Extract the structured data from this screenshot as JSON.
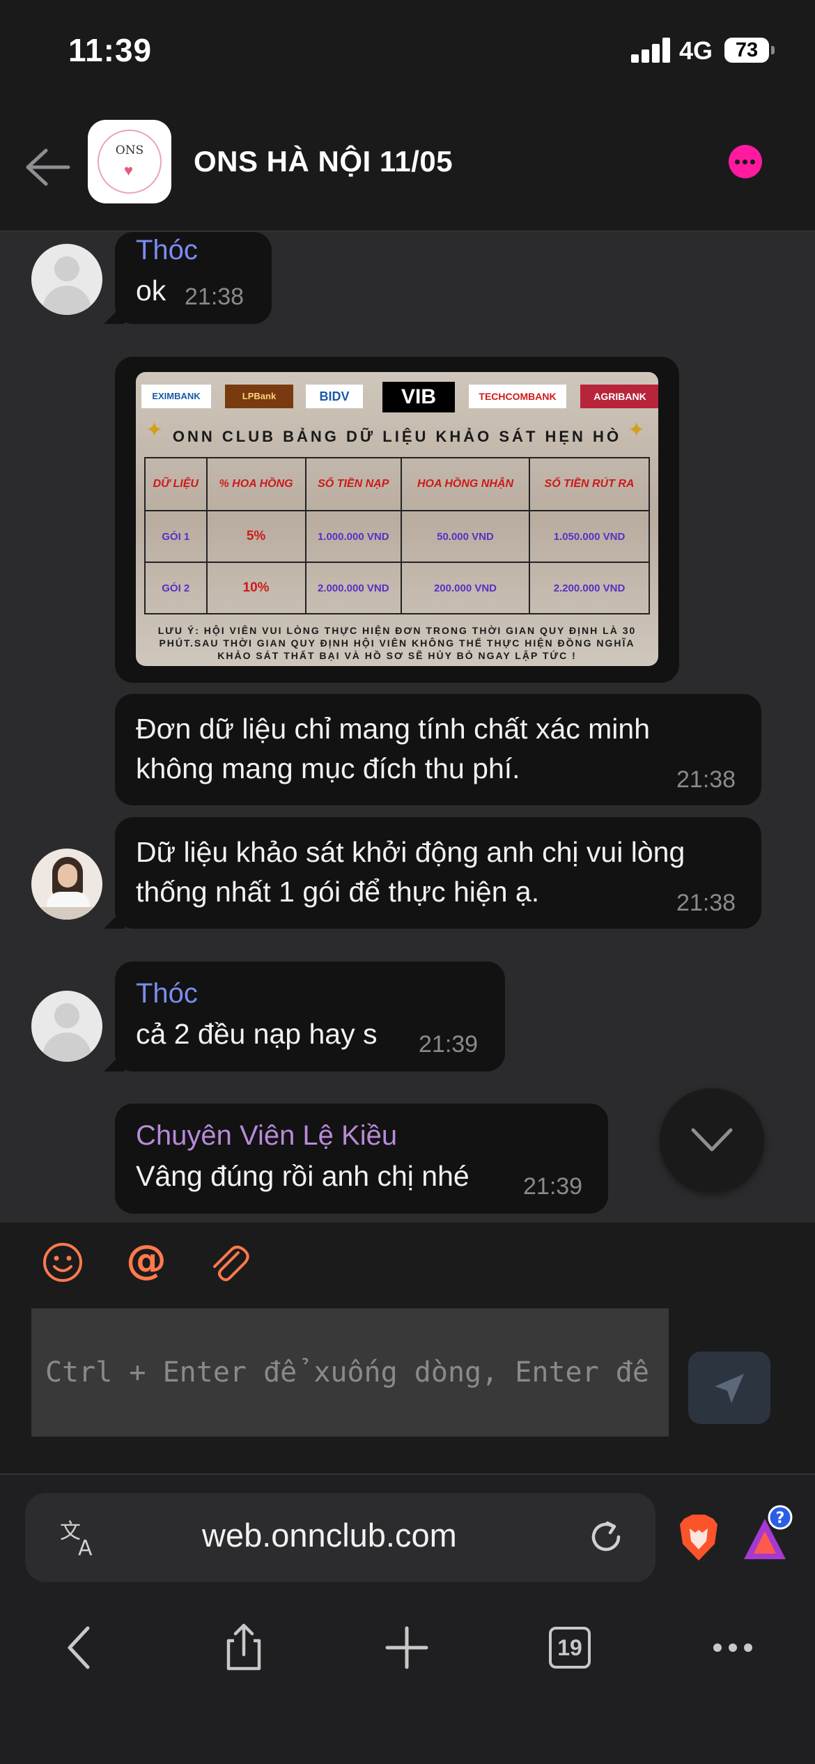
{
  "status": {
    "time": "11:39",
    "network": "4G",
    "battery": "73"
  },
  "header": {
    "title": "ONS HÀ NỘI 11/05",
    "group_avatar_text": "ONS"
  },
  "messages": [
    {
      "sender": "Thóc",
      "text": "ok",
      "time": "21:38"
    },
    {
      "text": "Đơn dữ liệu chỉ mang tính chất xác minh không mang mục đích thu phí.",
      "time": "21:38"
    },
    {
      "text": "Dữ liệu khảo sát khởi động anh chị vui lòng thống nhất 1 gói để thực hiện ạ.",
      "time": "21:38"
    },
    {
      "sender": "Thóc",
      "text": "cả 2 đều nạp hay s",
      "time": "21:39"
    },
    {
      "sender": "Chuyên Viên Lệ Kiều",
      "text": "Vâng đúng rồi anh chị nhé",
      "time": "21:39"
    }
  ],
  "survey_image": {
    "banks": [
      "EXIMBANK",
      "LPBank",
      "BIDV",
      "VIB",
      "TECHCOMBANK",
      "AGRIBANK"
    ],
    "title": "ONN CLUB BẢNG DỮ LIỆU KHẢO SÁT HẸN HÒ",
    "columns": [
      "DỮ LIỆU",
      "% HOA HỒNG",
      "SỐ TIỀN NẠP",
      "HOA HỒNG NHẬN",
      "SỐ TIỀN RÚT RA"
    ],
    "rows": [
      [
        "GÓI 1",
        "5%",
        "1.000.000 VND",
        "50.000 VND",
        "1.050.000 VND"
      ],
      [
        "GÓI 2",
        "10%",
        "2.000.000 VND",
        "200.000 VND",
        "2.200.000 VND"
      ]
    ],
    "note": "LƯU Ý: HỘI VIÊN VUI LÒNG THỰC HIỆN ĐƠN TRONG THỜI GIAN QUY ĐỊNH LÀ 30 PHÚT.SAU THỜI GIAN QUY ĐỊNH HỘI VIÊN KHÔNG THỂ THỰC HIỆN ĐỒNG NGHĨA KHẢO SÁT THẤT BẠI VÀ HỒ SƠ SẼ HỦY BỎ NGAY LẬP TỨC !"
  },
  "composer": {
    "placeholder": "Ctrl + Enter để xuống dòng, Enter để gửi"
  },
  "browser": {
    "url": "web.onnclub.com",
    "tab_count": "19"
  },
  "colors": {
    "accent": "#ff1aa0",
    "sender_blue": "#7c8cf0",
    "sender_purple": "#b88ad8",
    "tool_orange": "#ff7a4d"
  }
}
